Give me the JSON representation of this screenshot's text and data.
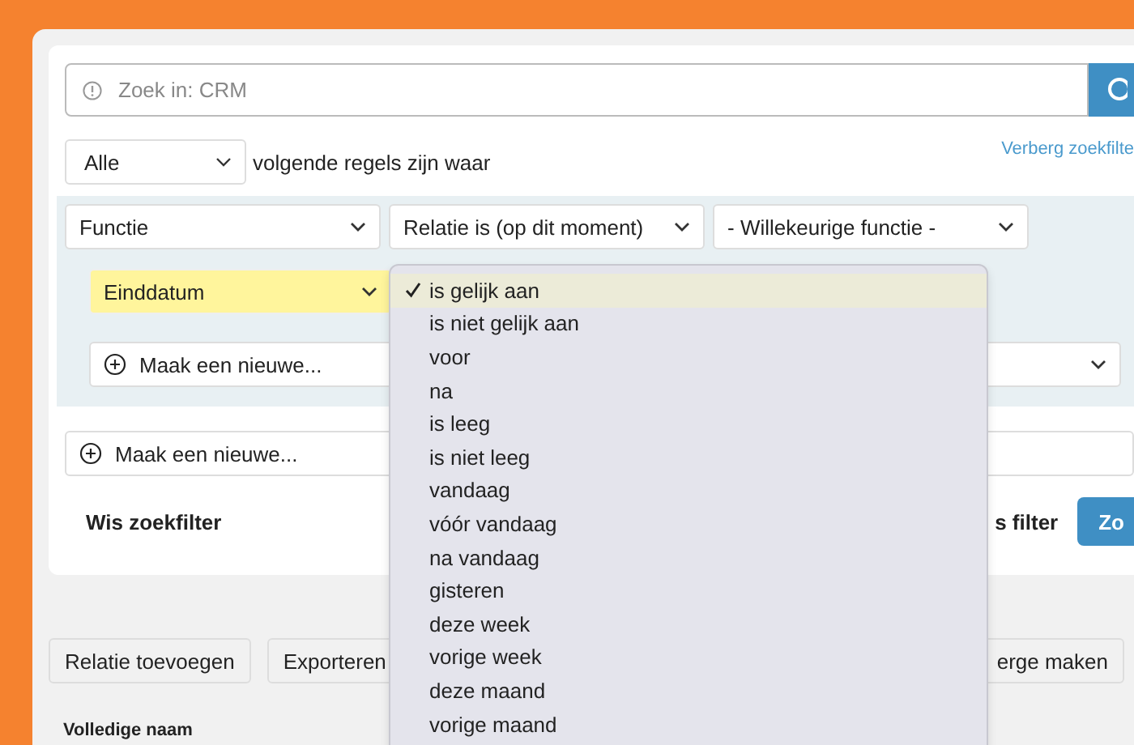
{
  "search": {
    "placeholder": "Zoek in: CRM"
  },
  "match": {
    "value": "Alle",
    "text": "volgende regels zijn waar"
  },
  "hide_link": "Verberg zoekfilte",
  "rule": {
    "selects": [
      "Functie",
      "Relatie is (op dit moment)",
      "- Willekeurige functie -"
    ]
  },
  "subrule": {
    "field": "Einddatum",
    "highlighted": true
  },
  "subrule_add": "Maak een nieuwe...",
  "rule_add": "Maak een nieuwe...",
  "footer": {
    "clear": "Wis zoekfilter",
    "save": "s filter",
    "search_button": "Zo"
  },
  "toolbar": [
    "Relatie toevoegen",
    "Exporteren",
    "erge maken"
  ],
  "table": {
    "columns": [
      "Volledige naam"
    ]
  },
  "dropdown": [
    {
      "label": "is gelijk aan",
      "selected": true
    },
    {
      "label": "is niet gelijk aan",
      "selected": false
    },
    {
      "label": "voor",
      "selected": false
    },
    {
      "label": "na",
      "selected": false
    },
    {
      "label": "is leeg",
      "selected": false
    },
    {
      "label": "is niet leeg",
      "selected": false
    },
    {
      "label": "vandaag",
      "selected": false
    },
    {
      "label": "vóór vandaag",
      "selected": false
    },
    {
      "label": "na vandaag",
      "selected": false
    },
    {
      "label": "gisteren",
      "selected": false
    },
    {
      "label": "deze week",
      "selected": false
    },
    {
      "label": "vorige week",
      "selected": false
    },
    {
      "label": "deze maand",
      "selected": false
    },
    {
      "label": "vorige maand",
      "selected": false
    }
  ]
}
